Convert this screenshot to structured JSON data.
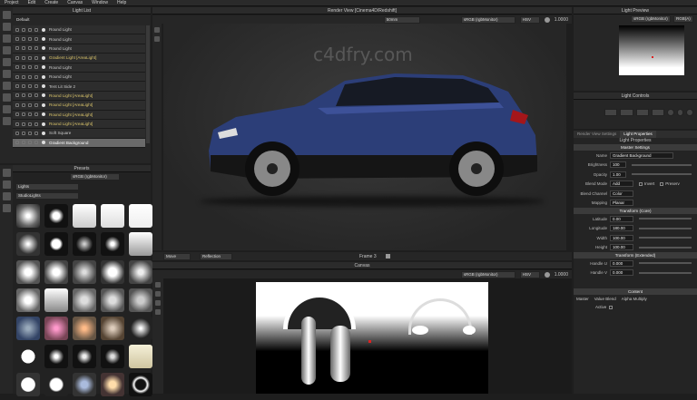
{
  "menu": [
    "Project",
    "Edit",
    "Create",
    "Canvas",
    "Window",
    "Help"
  ],
  "light_list": {
    "title": "Light List",
    "group": "Default",
    "items": [
      {
        "name": "Round Light",
        "kind": "normal"
      },
      {
        "name": "Round Light",
        "kind": "normal"
      },
      {
        "name": "Round Light",
        "kind": "normal"
      },
      {
        "name": "Gradient Light [AreaLight]",
        "kind": "area"
      },
      {
        "name": "Round Light",
        "kind": "normal"
      },
      {
        "name": "Round Light",
        "kind": "normal"
      },
      {
        "name": "Tent Lit Side 2",
        "kind": "normal"
      },
      {
        "name": "Round Light [AreaLight]",
        "kind": "area"
      },
      {
        "name": "Round Light [AreaLight]",
        "kind": "area"
      },
      {
        "name": "Round Light [AreaLight]",
        "kind": "area"
      },
      {
        "name": "Round Light [AreaLight]",
        "kind": "area"
      },
      {
        "name": "Soft Square",
        "kind": "normal"
      },
      {
        "name": "Gradient Background",
        "kind": "selected"
      }
    ]
  },
  "presets": {
    "title": "Presets",
    "color_space": "sRGB (rgbMonitor)",
    "category": "Lights",
    "subcategory": "StudioLights"
  },
  "render_view": {
    "title": "Render View [Cinema4D/Redshift]",
    "lens": "50mm",
    "color_space": "sRGB (rgbMonitor)",
    "mode": "HSV",
    "zoom": "1.0000",
    "watermark": "c4dfry.com",
    "move_label": "Move",
    "reflection_label": "Reflection",
    "frame_label": "Frame 3"
  },
  "canvas": {
    "title": "Canvas",
    "color_space": "sRGB (rgbMonitor)",
    "mode": "HSV",
    "zoom": "1.0000"
  },
  "light_preview": {
    "title": "Light Preview",
    "color_space": "sRGB (rgbMonitor)",
    "mode": "RGB(A)"
  },
  "light_controls": {
    "title": "Light Controls"
  },
  "properties": {
    "tab_render_settings": "Render View Settings",
    "tab_light_properties": "Light Properties",
    "heading": "Light Properties",
    "master_settings": "Master Settings",
    "name_label": "Name",
    "name_value": "Gradient Background",
    "brightness_label": "Brightness",
    "brightness_value": "100",
    "opacity_label": "Opacity",
    "opacity_value": "1.00",
    "blend_mode_label": "Blend Mode",
    "blend_mode_value": "Add",
    "invert_label": "Invert",
    "preserve_label": "Preserv",
    "blend_channel_label": "Blend Channel",
    "blend_channel_value": "Color",
    "mapping_label": "Mapping",
    "mapping_value": "Planar",
    "transform_core": "Transform (Core)",
    "latitude_label": "Latitude",
    "latitude_value": "0.00",
    "longitude_label": "Longitude",
    "longitude_value": "180.00",
    "width_label": "Width",
    "width_value": "100.00",
    "height_label": "Height",
    "height_value": "100.00",
    "transform_ext": "Transform (Extended)",
    "handle_u_label": "Handle U",
    "handle_u_value": "0.000",
    "handle_v_label": "Handle V",
    "handle_v_value": "0.000",
    "content": "Content",
    "master_label": "Master",
    "value_blend_label": "Value Blend",
    "alpha_multiply": "Alpha Multiply",
    "active_label": "Active"
  },
  "colors": {
    "car_blue": "#2c3e78",
    "viewport_bg": "#2a2a2a",
    "accent": "#d9c36a"
  }
}
